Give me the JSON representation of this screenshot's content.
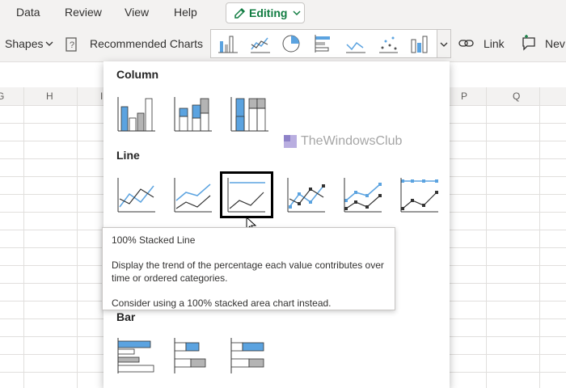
{
  "menu": {
    "items": [
      "Data",
      "Review",
      "View",
      "Help"
    ],
    "editing_label": "Editing"
  },
  "ribbon": {
    "shapes_label": "Shapes",
    "recommended_charts_label": "Recommended Charts",
    "link_label": "Link",
    "new_label": "Nev",
    "gallery_icons": [
      "column-chart-icon",
      "line-chart-icon",
      "pie-chart-icon",
      "bar-chart-icon",
      "area-chart-icon",
      "scatter-chart-icon",
      "other-charts-icon"
    ]
  },
  "sheet": {
    "columns_left": [
      "G",
      "H",
      "I"
    ],
    "columns_right": [
      "P",
      "Q"
    ]
  },
  "panel": {
    "column_title": "Column",
    "line_title": "Line",
    "bar_title": "Bar",
    "column_charts": [
      "Clustered Column",
      "Stacked Column",
      "100% Stacked Column"
    ],
    "line_charts": [
      "Line",
      "Stacked Line",
      "100% Stacked Line",
      "Line with Markers",
      "Stacked Line with Markers",
      "100% Stacked Line with Markers"
    ],
    "bar_charts": [
      "Clustered Bar",
      "Stacked Bar",
      "100% Stacked Bar"
    ]
  },
  "watermark": {
    "text": "TheWindowsClub"
  },
  "tooltip": {
    "title": "100% Stacked Line",
    "description": "Display the trend of the percentage each value contributes over",
    "description_line2": "time or ordered categories.",
    "note": "Consider using a 100% stacked area chart instead."
  },
  "colors": {
    "accent_blue": "#5ba3e0",
    "gray_fill": "#b4b4b4",
    "excel_green": "#107c41"
  }
}
